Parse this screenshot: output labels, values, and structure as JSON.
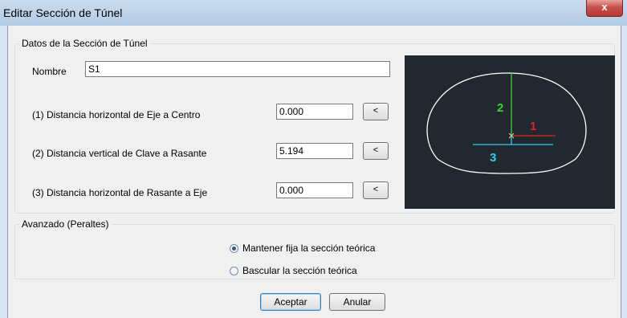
{
  "window": {
    "title": "Editar Sección de Túnel",
    "close_label": "x"
  },
  "group_section": {
    "legend": "Datos de la Sección de Túnel",
    "name_label": "Nombre",
    "name_value": "S1",
    "fields": [
      {
        "label": "(1) Distancia horizontal de Eje a Centro",
        "value": "0.000",
        "pick_label": "<"
      },
      {
        "label": "(2) Distancia vertical de Clave a Rasante",
        "value": "5.194",
        "pick_label": "<"
      },
      {
        "label": "(3) Distancia horizontal de Rasante a Eje",
        "value": "0.000",
        "pick_label": "<"
      }
    ]
  },
  "preview": {
    "background": "#212830",
    "labels": [
      {
        "text": "1",
        "color": "#e52020"
      },
      {
        "text": "2",
        "color": "#39d42a"
      },
      {
        "text": "3",
        "color": "#2fd0e8"
      }
    ]
  },
  "group_advanced": {
    "legend": "Avanzado (Peraltes)",
    "options": [
      {
        "label": "Mantener fija la sección teórica",
        "selected": true
      },
      {
        "label": "Bascular la sección teórica",
        "selected": false
      }
    ]
  },
  "buttons": {
    "ok": "Aceptar",
    "cancel": "Anular"
  }
}
